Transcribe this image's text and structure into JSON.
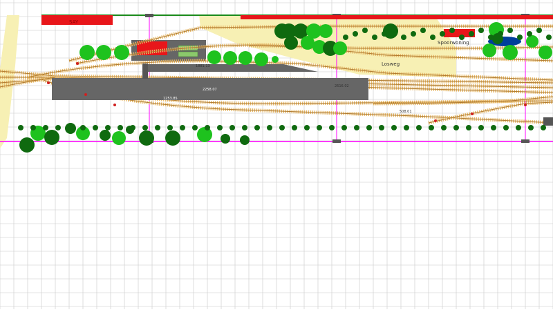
{
  "colors": {
    "background": "#ffffff",
    "grid": "#c8c8c8",
    "sand": "#f7f0b4",
    "track_sleeper": "#e6b96a",
    "track_rail": "#b07a2e",
    "platform": "#666666",
    "building": "#e8161a",
    "roof_green": "#8bc96b",
    "tree_light": "#1ec21e",
    "tree_dark": "#0f6a0f",
    "boundary": "#ff00ff",
    "top_line": "#1a8a1a",
    "water": "#003f9a",
    "marker": "#555555",
    "label": "#333333",
    "signal": "#d02020"
  },
  "labels": {
    "top_building": "SAY",
    "spoorwoning": "Spoorwoning",
    "losweg": "Losweg",
    "m1": "1881.13",
    "m2": "2258.07",
    "m3": "2616.02",
    "m4": "1253.85",
    "m5": "508.01"
  }
}
